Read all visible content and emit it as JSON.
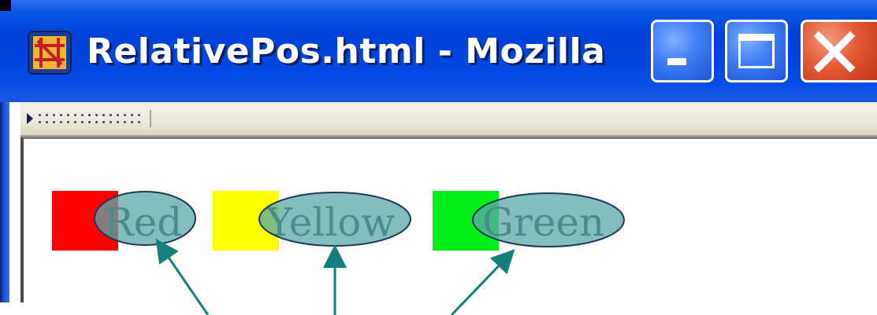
{
  "window": {
    "title": "RelativePos.html - Mozilla",
    "controls": {
      "minimize": "minimize",
      "maximize": "maximize",
      "close": "close"
    }
  },
  "content": {
    "boxes": [
      {
        "label": "Red",
        "color": "#ff0000"
      },
      {
        "label": "Yellow",
        "color": "#ffff00"
      },
      {
        "label": "Green",
        "color": "#00ee1a"
      }
    ]
  },
  "colors": {
    "titlebar": "#0046df",
    "ellipse_fill": "#5aa7a7",
    "ellipse_stroke": "#173a5a",
    "arrow": "#138080"
  }
}
